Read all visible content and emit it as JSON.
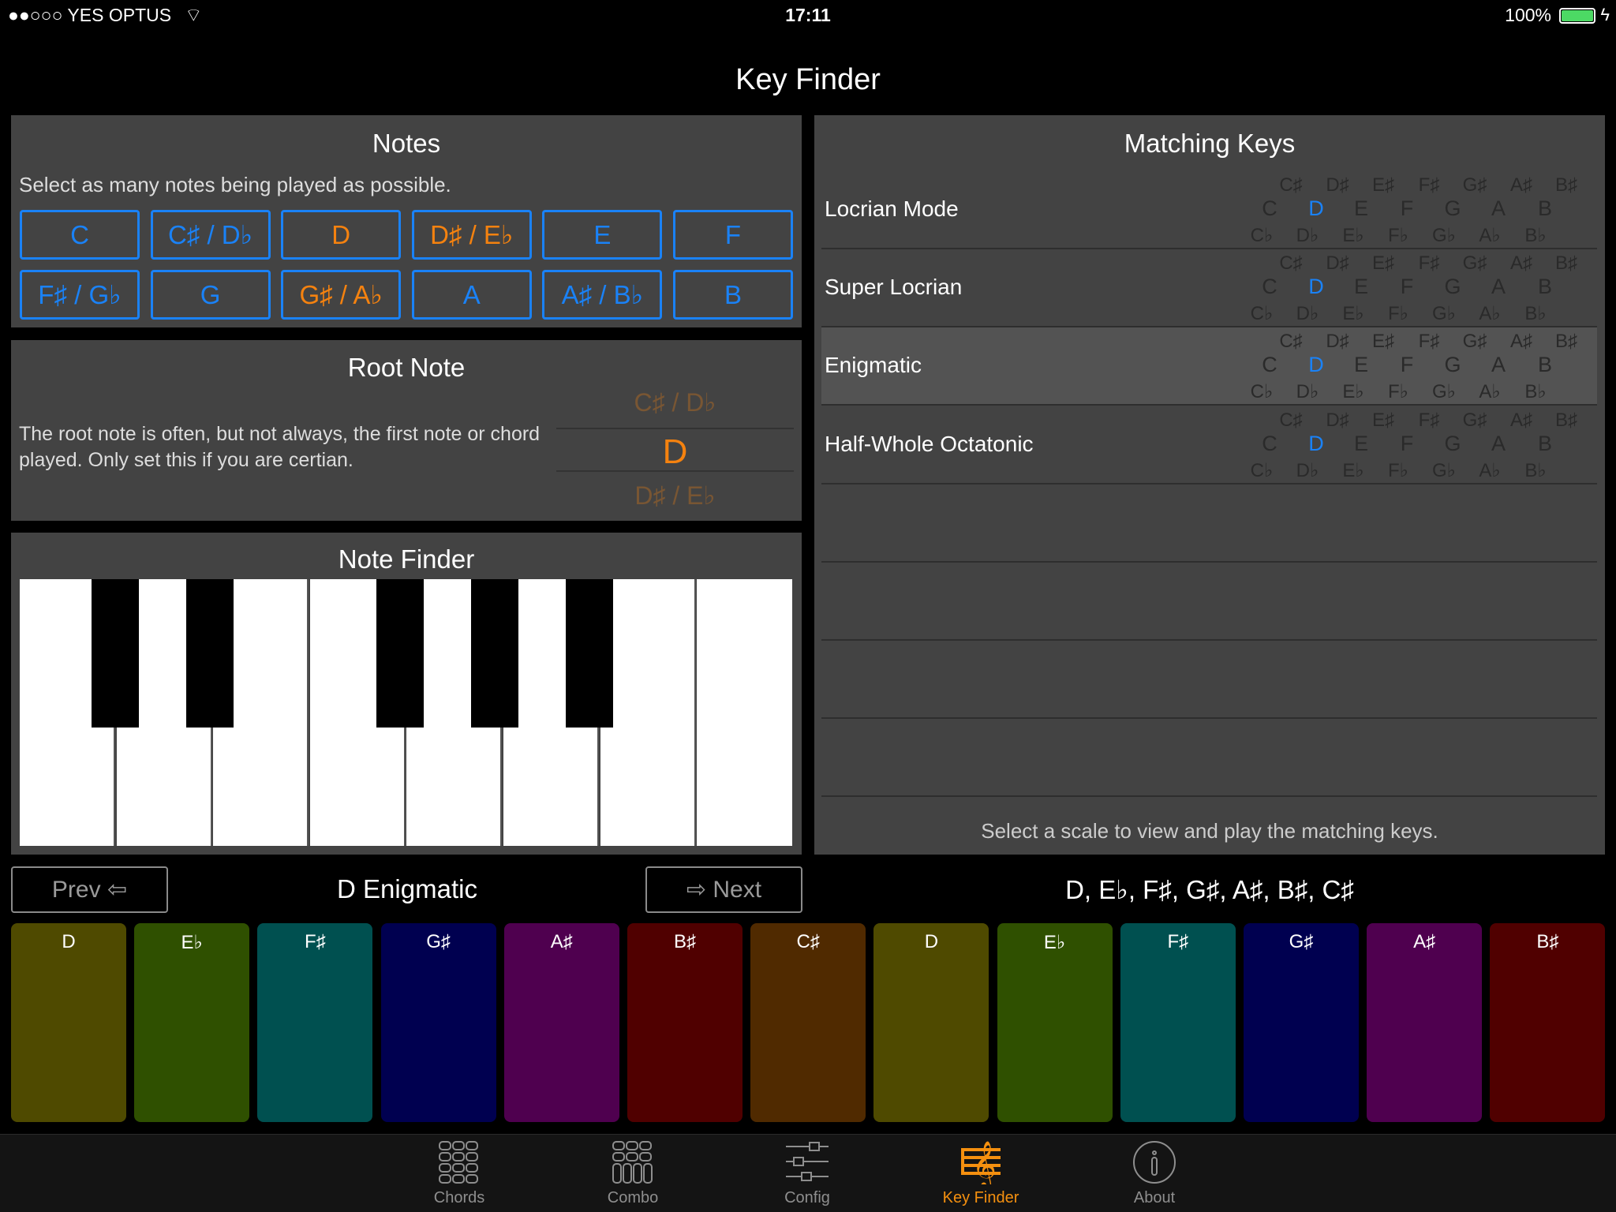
{
  "status": {
    "carrier": "●●○○○ YES OPTUS",
    "time": "17:11",
    "battery": "100%"
  },
  "title": "Key Finder",
  "notes": {
    "title": "Notes",
    "subtitle": "Select as many notes being played as possible.",
    "buttons": [
      {
        "label": "C",
        "sel": false
      },
      {
        "label": "C♯ / D♭",
        "sel": false
      },
      {
        "label": "D",
        "sel": true
      },
      {
        "label": "D♯ / E♭",
        "sel": true
      },
      {
        "label": "E",
        "sel": false
      },
      {
        "label": "F",
        "sel": false
      },
      {
        "label": "F♯ / G♭",
        "sel": false
      },
      {
        "label": "G",
        "sel": false
      },
      {
        "label": "G♯ / A♭",
        "sel": true
      },
      {
        "label": "A",
        "sel": false
      },
      {
        "label": "A♯ / B♭",
        "sel": false
      },
      {
        "label": "B",
        "sel": false
      }
    ]
  },
  "root": {
    "title": "Root Note",
    "text": "The root note is often, but not always, the first note or chord played. Only set this if you are certian.",
    "prev": "C♯ / D♭",
    "current": "D",
    "next": "D♯ / E♭"
  },
  "finder": {
    "title": "Note Finder"
  },
  "matching": {
    "title": "Matching Keys",
    "footer": "Select a scale to view and play the matching keys.",
    "sharps": [
      "C♯",
      "D♯",
      "E♯",
      "F♯",
      "G♯",
      "A♯",
      "B♯"
    ],
    "naturals": [
      "C",
      "D",
      "E",
      "F",
      "G",
      "A",
      "B"
    ],
    "flats": [
      "C♭",
      "D♭",
      "E♭",
      "F♭",
      "G♭",
      "A♭",
      "B♭"
    ],
    "highlighted": "D",
    "rows": [
      {
        "name": "Locrian Mode"
      },
      {
        "name": "Super Locrian"
      },
      {
        "name": "Enigmatic",
        "selected": true
      },
      {
        "name": "Half-Whole Octatonic"
      }
    ]
  },
  "nav": {
    "prev": "Prev ⇦",
    "next": "⇨ Next",
    "scale": "D Enigmatic",
    "notes": "D, E♭, F♯, G♯, A♯, B♯, C♯"
  },
  "pads": [
    {
      "label": "D",
      "color": "#4f4a00"
    },
    {
      "label": "E♭",
      "color": "#2f5000"
    },
    {
      "label": "F♯",
      "color": "#005050"
    },
    {
      "label": "G♯",
      "color": "#000050"
    },
    {
      "label": "A♯",
      "color": "#4f004f"
    },
    {
      "label": "B♯",
      "color": "#500000"
    },
    {
      "label": "C♯",
      "color": "#502a00"
    },
    {
      "label": "D",
      "color": "#4f4a00"
    },
    {
      "label": "E♭",
      "color": "#2f5000"
    },
    {
      "label": "F♯",
      "color": "#005050"
    },
    {
      "label": "G♯",
      "color": "#000050"
    },
    {
      "label": "A♯",
      "color": "#4f004f"
    },
    {
      "label": "B♯",
      "color": "#500000"
    }
  ],
  "tabs": [
    {
      "label": "Chords",
      "icon": "grid-icon"
    },
    {
      "label": "Combo",
      "icon": "combo-grid-icon"
    },
    {
      "label": "Config",
      "icon": "sliders-icon"
    },
    {
      "label": "Key Finder",
      "icon": "treble-clef-icon",
      "active": true
    },
    {
      "label": "About",
      "icon": "info-icon"
    }
  ],
  "colors": {
    "accent": "#1a82f7",
    "selected": "#f5820f",
    "panel": "#434343"
  }
}
